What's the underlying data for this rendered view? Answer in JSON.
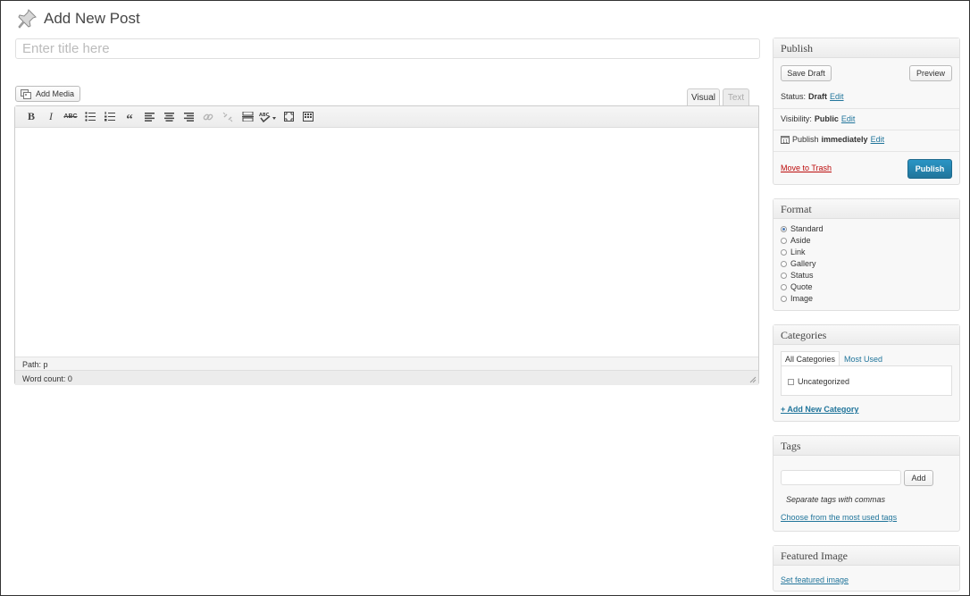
{
  "header": {
    "title": "Add New Post",
    "icon": "pushpin-icon"
  },
  "title_field": {
    "value": "",
    "placeholder": "Enter title here"
  },
  "toolbar": {
    "add_media_label": "Add Media"
  },
  "editor": {
    "tabs": [
      {
        "label": "Visual",
        "active": true
      },
      {
        "label": "Text",
        "active": false
      }
    ],
    "format_buttons": [
      {
        "name": "bold-icon",
        "glyph": "B"
      },
      {
        "name": "italic-icon",
        "glyph": "I"
      },
      {
        "name": "strikethrough-icon",
        "glyph": "ABC"
      },
      {
        "name": "bullet-list-icon"
      },
      {
        "name": "numbered-list-icon"
      },
      {
        "name": "blockquote-icon",
        "glyph": "“"
      },
      {
        "name": "align-left-icon"
      },
      {
        "name": "align-center-icon"
      },
      {
        "name": "align-right-icon"
      },
      {
        "name": "insert-link-icon",
        "disabled": true
      },
      {
        "name": "unlink-icon",
        "disabled": true
      },
      {
        "name": "insert-more-tag-icon"
      },
      {
        "name": "spellcheck-icon",
        "glyph": "ABC"
      },
      {
        "name": "fullscreen-icon"
      },
      {
        "name": "kitchen-sink-icon"
      }
    ],
    "path_label": "Path: p",
    "word_count_label": "Word count: 0"
  },
  "publish_box": {
    "title": "Publish",
    "save_draft_label": "Save Draft",
    "preview_label": "Preview",
    "status_label": "Status:",
    "status_value": "Draft",
    "visibility_label": "Visibility:",
    "visibility_value": "Public",
    "publish_label": "Publish",
    "publish_value": "immediately",
    "edit_label": "Edit",
    "trash_label": "Move to Trash",
    "publish_button_label": "Publish",
    "accent_color": "#21759b",
    "trash_color": "#bc0b0b"
  },
  "format_box": {
    "title": "Format",
    "options": [
      "Standard",
      "Aside",
      "Link",
      "Gallery",
      "Status",
      "Quote",
      "Image"
    ],
    "selected": "Standard"
  },
  "categories_box": {
    "title": "Categories",
    "tabs": [
      "All Categories",
      "Most Used"
    ],
    "items": [
      {
        "label": "Uncategorized",
        "checked": false
      }
    ],
    "add_link": "+ Add New Category"
  },
  "tags_box": {
    "title": "Tags",
    "input_value": "",
    "add_label": "Add",
    "hint": "Separate tags with commas",
    "choose_link": "Choose from the most used tags"
  },
  "featured_image_box": {
    "title": "Featured Image",
    "set_link": "Set featured image"
  }
}
